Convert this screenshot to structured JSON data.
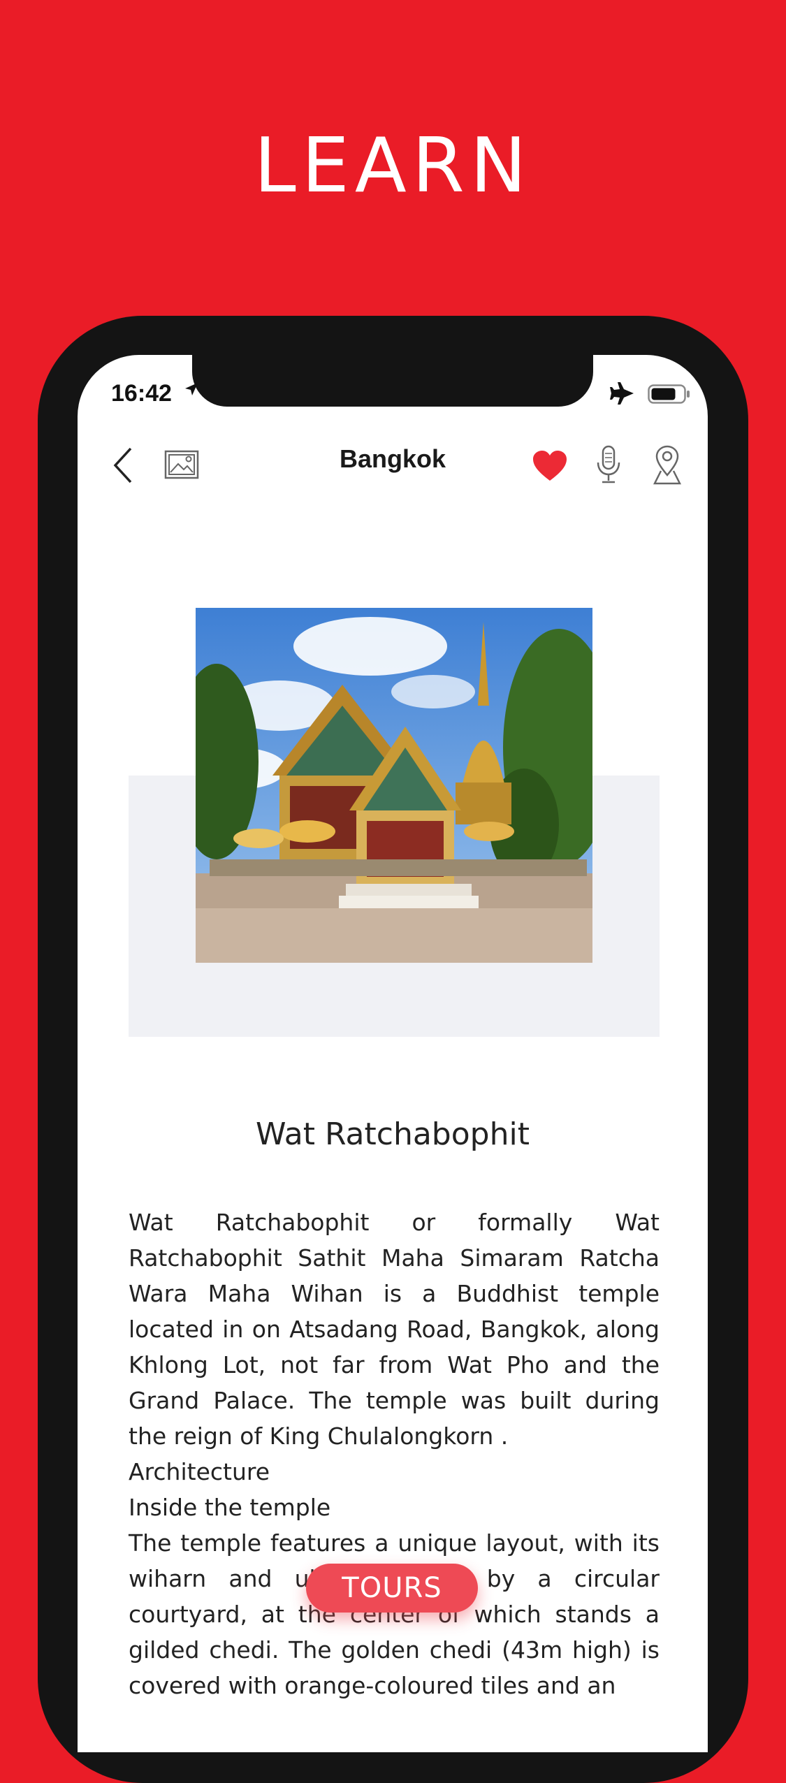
{
  "hero": {
    "title": "LEARN"
  },
  "status_bar": {
    "time": "16:42"
  },
  "nav": {
    "title": "Bangkok"
  },
  "place": {
    "title": "Wat Ratchabophit"
  },
  "description": {
    "intro": "Wat Ratchabophit or formally Wat Ratchabophit Sathit Maha Simaram Ratcha Wara Maha Wihan is a Buddhist temple located in on Atsadang Road, Bangkok, along Khlong Lot, not far from Wat Pho and the Grand Palace. The temple was built during the reign of King Chulalongkorn .",
    "heading1": "Architecture",
    "heading2": "Inside the temple",
    "body": "The temple features a unique layout, with its wiharn and ubosot linked by a circular courtyard, at the center of which stands a gilded chedi. The golden chedi (43m high) is covered with orange-coloured tiles and an"
  },
  "tours_button": {
    "label": "TOURS"
  },
  "colors": {
    "brand_red": "#ea1c27",
    "heart_red": "#ec2a35",
    "button_red": "#ee4a55",
    "backdrop": "#f0f1f5"
  },
  "icons": [
    "back-arrow-icon",
    "gallery-icon",
    "heart-icon",
    "audio-guide-icon",
    "map-pin-icon",
    "location-arrow-icon",
    "airplane-icon",
    "battery-icon"
  ]
}
